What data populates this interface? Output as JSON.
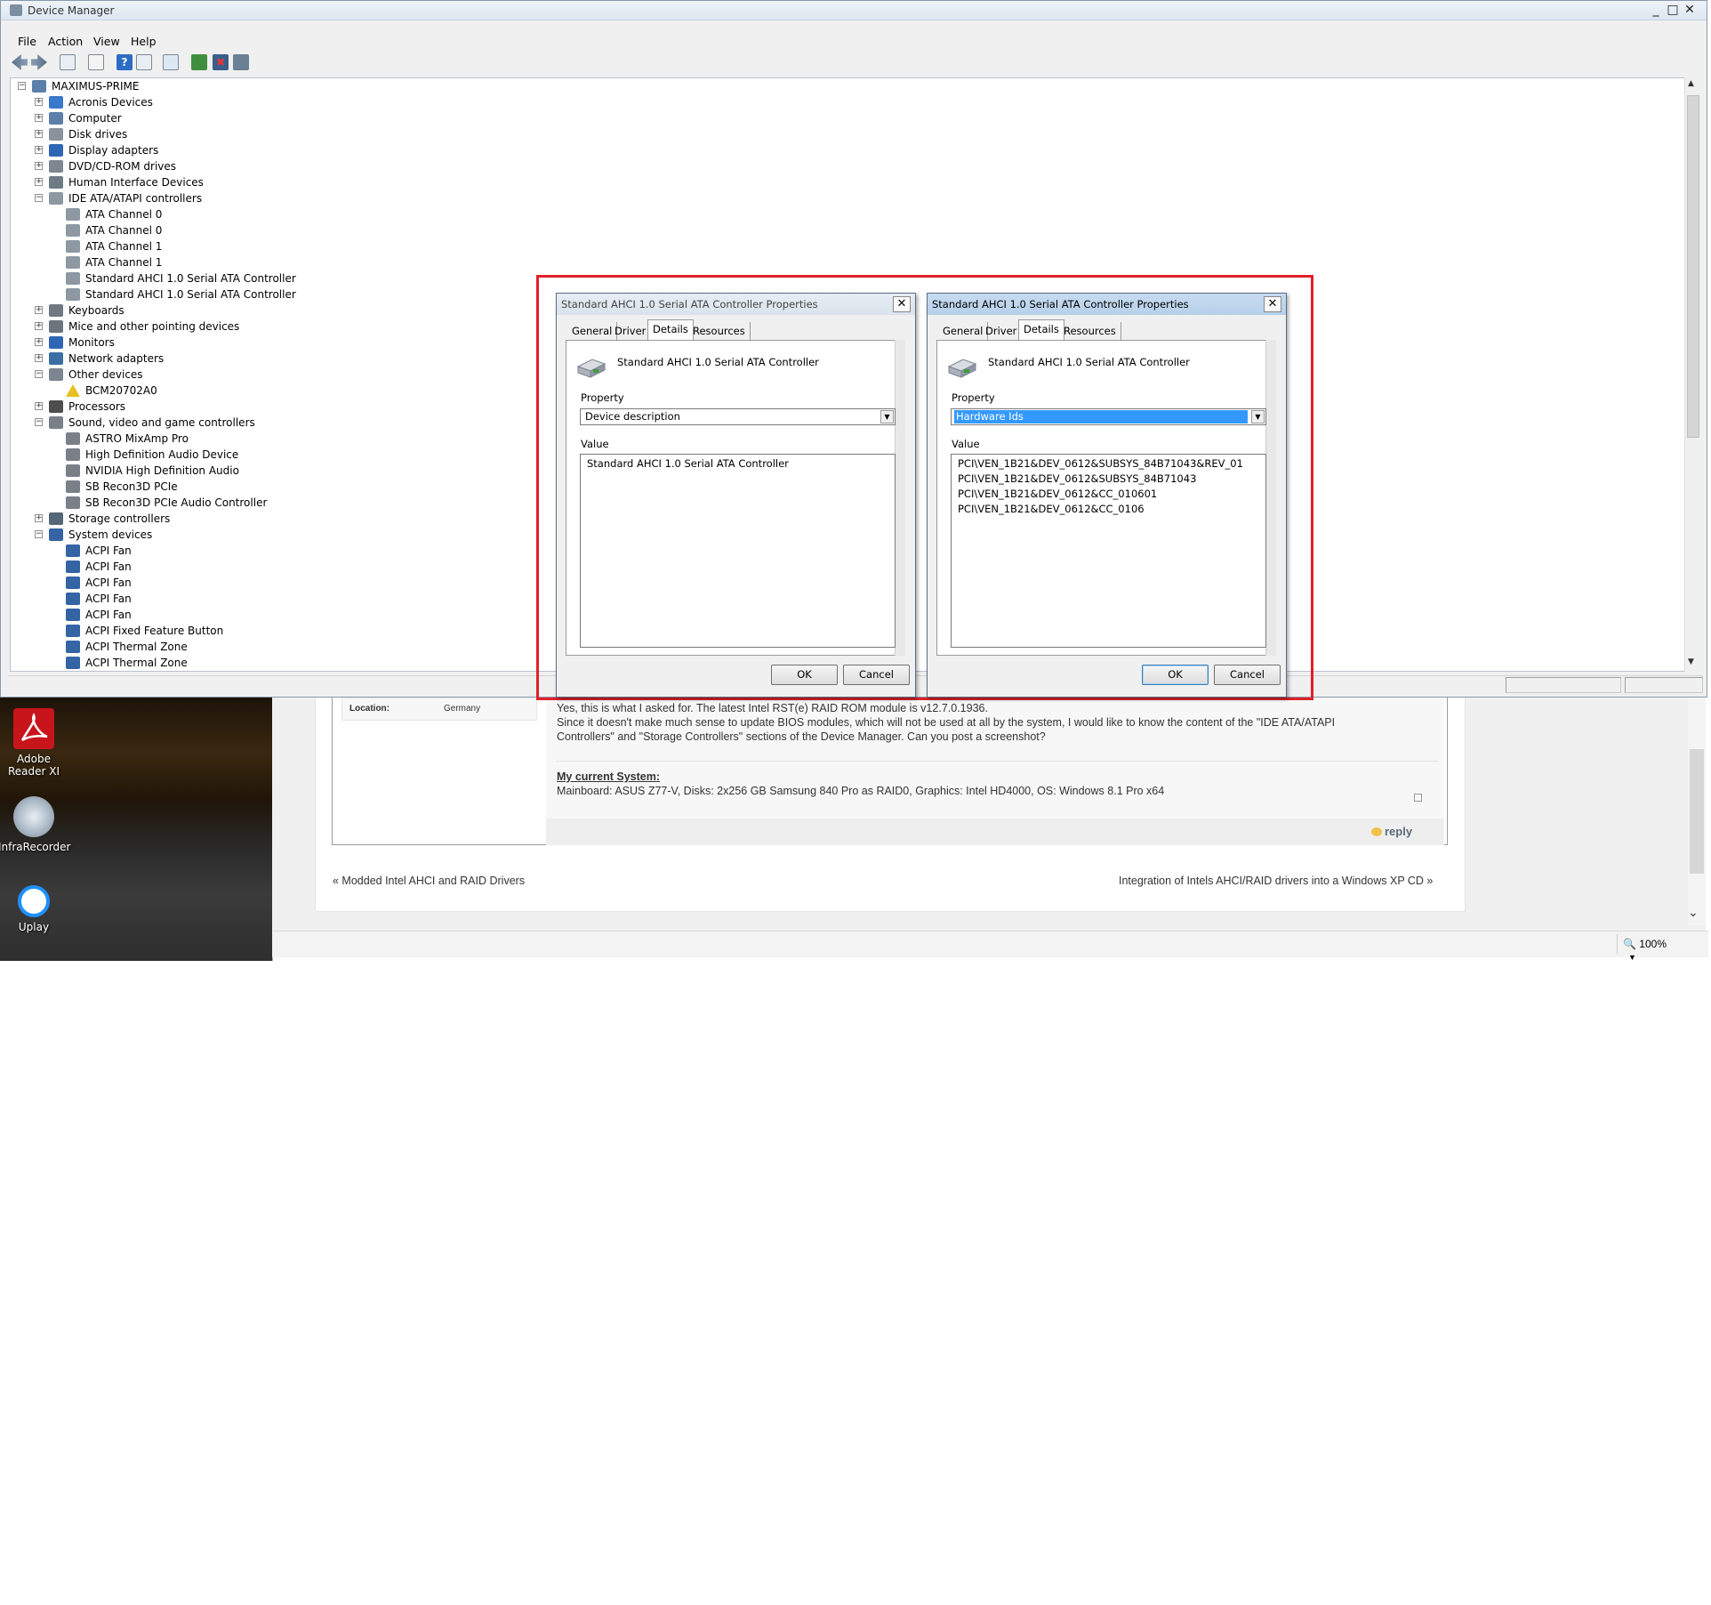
{
  "desktop": {
    "icons": [
      {
        "name": "adobe-reader-icon",
        "label": "Adobe Reader XI"
      },
      {
        "name": "infrarecorder-icon",
        "label": "InfraRecorder"
      },
      {
        "name": "uplay-icon",
        "label": "Uplay"
      }
    ]
  },
  "browser": {
    "location_label": "Location:",
    "location_value": "Germany",
    "post_lines": [
      "Yes, this is what I asked for. The latest Intel RST(e) RAID ROM module is v12.7.0.1936.",
      "Since it doesn't make much sense to update BIOS modules, which will not be used at all by the system, I would like to know the content of the \"IDE ATA/ATAPI",
      "Controllers\" and \"Storage Controllers\" sections of the Device Manager. Can you post a screenshot?"
    ],
    "signature_heading": "My current System:",
    "signature_text": "Mainboard: ASUS Z77-V, Disks: 2x256 GB Samsung 840 Pro as RAID0, Graphics: Intel HD4000, OS: Windows 8.1 Pro x64",
    "reply_label": "reply",
    "prev_link": "« Modded Intel AHCI and RAID Drivers",
    "next_link": "Integration of Intels AHCI/RAID drivers into a Windows XP CD »",
    "zoom": "100%"
  },
  "device_manager": {
    "title": "Device Manager",
    "controls": {
      "minimize": "_",
      "maximize": "□",
      "close": "✕"
    },
    "menu": [
      "File",
      "Action",
      "View",
      "Help"
    ],
    "tree": [
      {
        "level": 0,
        "exp": "-",
        "icon": "computer",
        "label": "MAXIMUS-PRIME"
      },
      {
        "level": 1,
        "exp": "+",
        "icon": "acronis",
        "label": "Acronis Devices"
      },
      {
        "level": 1,
        "exp": "+",
        "icon": "computer",
        "label": "Computer"
      },
      {
        "level": 1,
        "exp": "+",
        "icon": "disk",
        "label": "Disk drives"
      },
      {
        "level": 1,
        "exp": "+",
        "icon": "display",
        "label": "Display adapters"
      },
      {
        "level": 1,
        "exp": "+",
        "icon": "dvd",
        "label": "DVD/CD-ROM drives"
      },
      {
        "level": 1,
        "exp": "+",
        "icon": "hid",
        "label": "Human Interface Devices"
      },
      {
        "level": 1,
        "exp": "-",
        "icon": "ide",
        "label": "IDE ATA/ATAPI controllers"
      },
      {
        "level": 2,
        "exp": "",
        "icon": "ide",
        "label": "ATA Channel 0"
      },
      {
        "level": 2,
        "exp": "",
        "icon": "ide",
        "label": "ATA Channel 0"
      },
      {
        "level": 2,
        "exp": "",
        "icon": "ide",
        "label": "ATA Channel 1"
      },
      {
        "level": 2,
        "exp": "",
        "icon": "ide",
        "label": "ATA Channel 1"
      },
      {
        "level": 2,
        "exp": "",
        "icon": "ide",
        "label": "Standard AHCI 1.0 Serial ATA Controller"
      },
      {
        "level": 2,
        "exp": "",
        "icon": "ide",
        "label": "Standard AHCI 1.0 Serial ATA Controller"
      },
      {
        "level": 1,
        "exp": "+",
        "icon": "keyboard",
        "label": "Keyboards"
      },
      {
        "level": 1,
        "exp": "+",
        "icon": "mouse",
        "label": "Mice and other pointing devices"
      },
      {
        "level": 1,
        "exp": "+",
        "icon": "display",
        "label": "Monitors"
      },
      {
        "level": 1,
        "exp": "+",
        "icon": "network",
        "label": "Network adapters"
      },
      {
        "level": 1,
        "exp": "-",
        "icon": "other",
        "label": "Other devices"
      },
      {
        "level": 2,
        "exp": "",
        "icon": "warning",
        "label": "BCM20702A0"
      },
      {
        "level": 1,
        "exp": "+",
        "icon": "cpu",
        "label": "Processors"
      },
      {
        "level": 1,
        "exp": "-",
        "icon": "sound",
        "label": "Sound, video and game controllers"
      },
      {
        "level": 2,
        "exp": "",
        "icon": "sound",
        "label": "ASTRO MixAmp Pro"
      },
      {
        "level": 2,
        "exp": "",
        "icon": "sound",
        "label": "High Definition Audio Device"
      },
      {
        "level": 2,
        "exp": "",
        "icon": "sound",
        "label": "NVIDIA High Definition Audio"
      },
      {
        "level": 2,
        "exp": "",
        "icon": "sound",
        "label": "SB Recon3D PCIe"
      },
      {
        "level": 2,
        "exp": "",
        "icon": "sound",
        "label": "SB Recon3D PCIe Audio Controller"
      },
      {
        "level": 1,
        "exp": "+",
        "icon": "storage",
        "label": "Storage controllers"
      },
      {
        "level": 1,
        "exp": "-",
        "icon": "system",
        "label": "System devices"
      },
      {
        "level": 2,
        "exp": "",
        "icon": "system",
        "label": "ACPI Fan"
      },
      {
        "level": 2,
        "exp": "",
        "icon": "system",
        "label": "ACPI Fan"
      },
      {
        "level": 2,
        "exp": "",
        "icon": "system",
        "label": "ACPI Fan"
      },
      {
        "level": 2,
        "exp": "",
        "icon": "system",
        "label": "ACPI Fan"
      },
      {
        "level": 2,
        "exp": "",
        "icon": "system",
        "label": "ACPI Fan"
      },
      {
        "level": 2,
        "exp": "",
        "icon": "system",
        "label": "ACPI Fixed Feature Button"
      },
      {
        "level": 2,
        "exp": "",
        "icon": "system",
        "label": "ACPI Thermal Zone"
      },
      {
        "level": 2,
        "exp": "",
        "icon": "system",
        "label": "ACPI Thermal Zone"
      }
    ]
  },
  "dialogs": [
    {
      "title": "Standard AHCI 1.0 Serial ATA Controller Properties",
      "active": false,
      "tabs": [
        "General",
        "Driver",
        "Details",
        "Resources"
      ],
      "selected_tab": "Details",
      "device_name": "Standard AHCI 1.0 Serial ATA Controller",
      "property_label": "Property",
      "property_value": "Device description",
      "property_highlighted": false,
      "value_label": "Value",
      "values": [
        "Standard AHCI 1.0 Serial ATA Controller"
      ],
      "ok": "OK",
      "cancel": "Cancel"
    },
    {
      "title": "Standard AHCI 1.0 Serial ATA Controller Properties",
      "active": true,
      "tabs": [
        "General",
        "Driver",
        "Details",
        "Resources"
      ],
      "selected_tab": "Details",
      "device_name": "Standard AHCI 1.0 Serial ATA Controller",
      "property_label": "Property",
      "property_value": "Hardware Ids",
      "property_highlighted": true,
      "value_label": "Value",
      "values": [
        "PCI\\VEN_1B21&DEV_0612&SUBSYS_84B71043&REV_01",
        "PCI\\VEN_1B21&DEV_0612&SUBSYS_84B71043",
        "PCI\\VEN_1B21&DEV_0612&CC_010601",
        "PCI\\VEN_1B21&DEV_0612&CC_0106"
      ],
      "ok": "OK",
      "cancel": "Cancel"
    }
  ],
  "colors": {
    "highlight_border": "#e0202a",
    "selection": "#3399ff",
    "titlebar": "#dde7f1"
  }
}
